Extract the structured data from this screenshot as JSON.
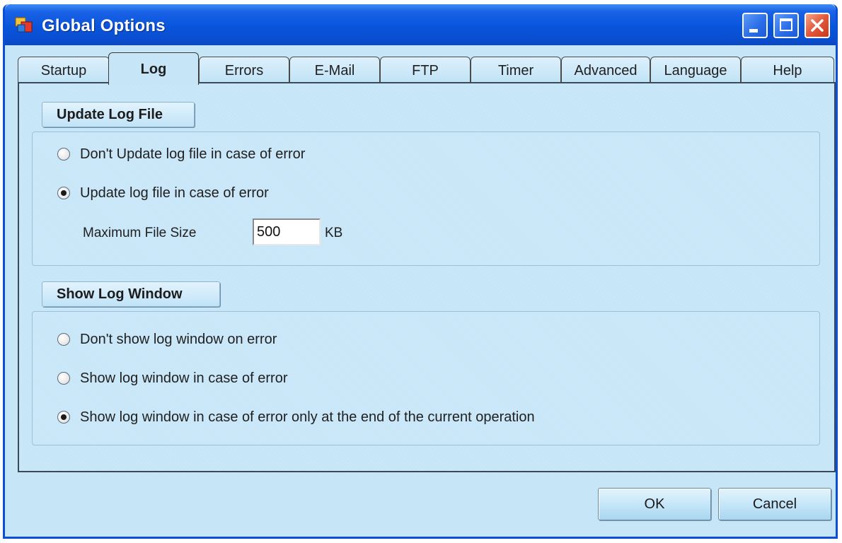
{
  "window": {
    "title": "Global Options"
  },
  "tabs": [
    {
      "label": "Startup"
    },
    {
      "label": "Log",
      "active": true
    },
    {
      "label": "Errors"
    },
    {
      "label": "E-Mail"
    },
    {
      "label": "FTP"
    },
    {
      "label": "Timer"
    },
    {
      "label": "Advanced"
    },
    {
      "label": "Language"
    },
    {
      "label": "Help"
    }
  ],
  "update_log": {
    "header": "Update Log File",
    "options": [
      {
        "label": "Don't Update log file in case of error",
        "checked": false
      },
      {
        "label": "Update log file in case of error",
        "checked": true
      }
    ],
    "max_size_label": "Maximum File Size",
    "max_size_value": "500",
    "max_size_unit": "KB"
  },
  "show_log": {
    "header": "Show Log Window",
    "options": [
      {
        "label": "Don't show log window on error",
        "checked": false
      },
      {
        "label": "Show log window in case of error",
        "checked": false
      },
      {
        "label": "Show log window in case of error only at the end of the current operation",
        "checked": true
      }
    ]
  },
  "buttons": {
    "ok": "OK",
    "cancel": "Cancel"
  },
  "colors": {
    "titlebar": "#0855dd",
    "window_bg": "#c6e6f8",
    "close_button": "#e2573a"
  }
}
